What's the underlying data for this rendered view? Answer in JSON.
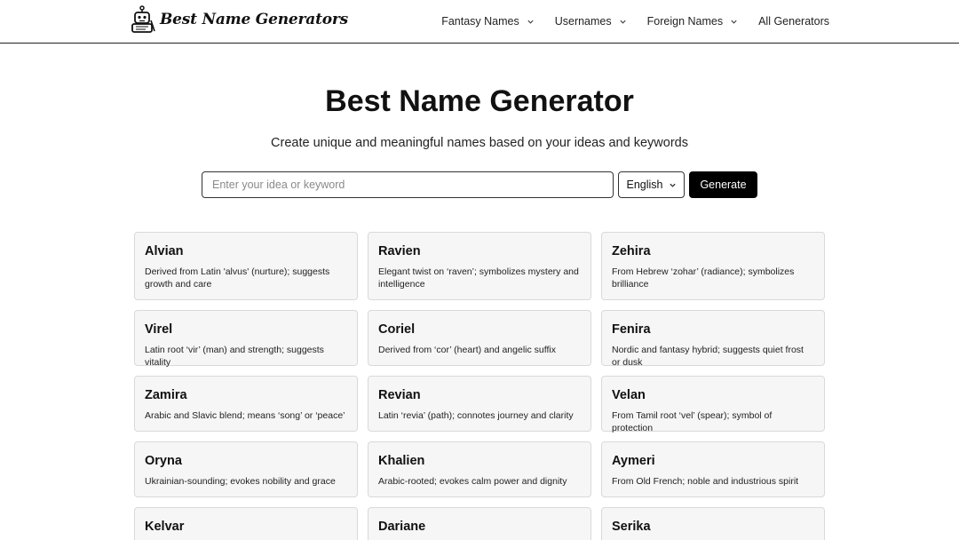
{
  "header": {
    "brand": "Best Name Generators",
    "nav": [
      {
        "label": "Fantasy Names",
        "dropdown": true
      },
      {
        "label": "Usernames",
        "dropdown": true
      },
      {
        "label": "Foreign Names",
        "dropdown": true
      },
      {
        "label": "All Generators",
        "dropdown": false
      }
    ]
  },
  "hero": {
    "title": "Best Name Generator",
    "subtitle": "Create unique and meaningful names based on your ideas and keywords"
  },
  "form": {
    "placeholder": "Enter your idea or keyword",
    "value": "",
    "language": "English",
    "generate_label": "Generate"
  },
  "cards": [
    {
      "name": "Alvian",
      "desc": "Derived from Latin 'alvus' (nurture); suggests growth and care"
    },
    {
      "name": "Ravien",
      "desc": "Elegant twist on ‘raven’; symbolizes mystery and intelligence"
    },
    {
      "name": "Zehira",
      "desc": "From Hebrew ‘zohar’ (radiance); symbolizes brilliance"
    },
    {
      "name": "Virel",
      "desc": "Latin root ‘vir’ (man) and strength; suggests vitality"
    },
    {
      "name": "Coriel",
      "desc": "Derived from ‘cor’ (heart) and angelic suffix"
    },
    {
      "name": "Fenira",
      "desc": "Nordic and fantasy hybrid; suggests quiet frost or dusk"
    },
    {
      "name": "Zamira",
      "desc": "Arabic and Slavic blend; means ‘song’ or ‘peace’"
    },
    {
      "name": "Revian",
      "desc": "Latin ‘revia’ (path); connotes journey and clarity"
    },
    {
      "name": "Velan",
      "desc": "From Tamil root ‘vel’ (spear); symbol of protection"
    },
    {
      "name": "Oryna",
      "desc": "Ukrainian-sounding; evokes nobility and grace"
    },
    {
      "name": "Khalien",
      "desc": "Arabic-rooted; evokes calm power and dignity"
    },
    {
      "name": "Aymeri",
      "desc": "From Old French; noble and industrious spirit"
    },
    {
      "name": "Kelvar",
      "desc": ""
    },
    {
      "name": "Dariane",
      "desc": ""
    },
    {
      "name": "Serika",
      "desc": ""
    }
  ]
}
